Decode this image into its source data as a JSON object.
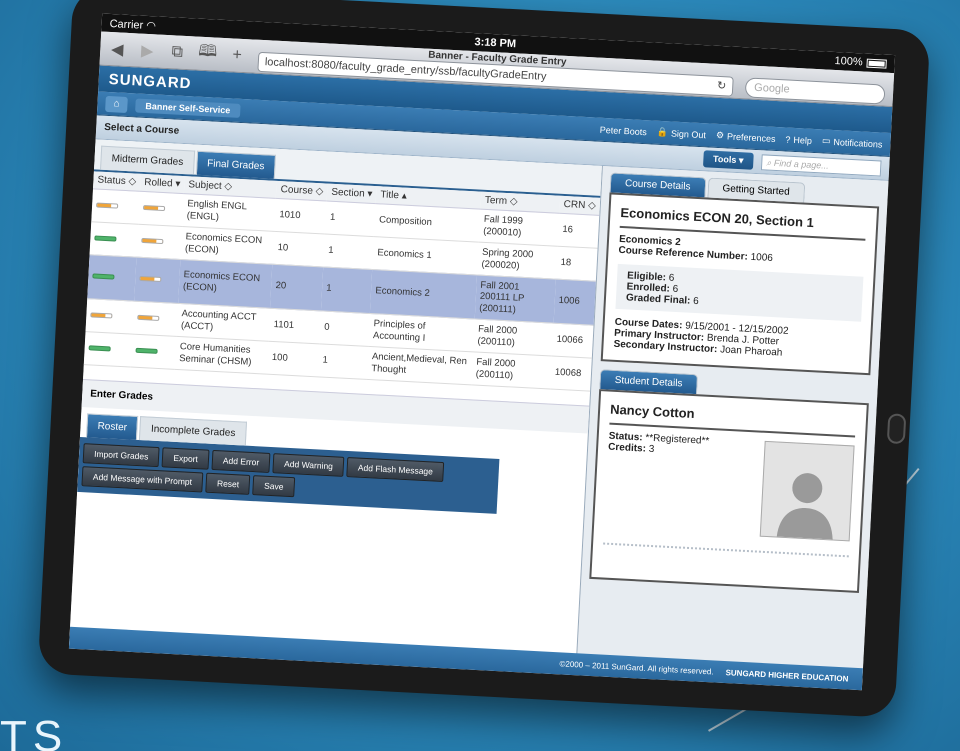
{
  "slide": {
    "partial_text": "TS"
  },
  "status_bar": {
    "carrier": "Carrier",
    "time": "3:18 PM",
    "battery": "100%"
  },
  "browser": {
    "page_title": "Banner - Faculty Grade Entry",
    "url": "localhost:8080/faculty_grade_entry/ssb/facultyGradeEntry",
    "search_placeholder": "Google"
  },
  "header": {
    "brand": "SUNGARD",
    "breadcrumb": "Banner Self-Service",
    "user": "Peter Boots",
    "sign_out": "Sign Out",
    "preferences": "Preferences",
    "help": "Help",
    "notifications": "Notifications"
  },
  "toolbar": {
    "title": "Select a Course",
    "tools": "Tools",
    "find_placeholder": "Find a page..."
  },
  "course_tabs": [
    "Midterm Grades",
    "Final Grades"
  ],
  "table": {
    "headers": [
      "Status",
      "Rolled",
      "Subject",
      "Course",
      "Section",
      "Title",
      "Term",
      "CRN"
    ],
    "rows": [
      {
        "status": "orange",
        "rolled": "orange",
        "subject": "English ENGL (ENGL)",
        "course": "1010",
        "section": "1",
        "title": "Composition",
        "term": "Fall 1999 (200010)",
        "crn": "16"
      },
      {
        "status": "green",
        "rolled": "orange",
        "subject": "Economics ECON (ECON)",
        "course": "10",
        "section": "1",
        "title": "Economics 1",
        "term": "Spring 2000 (200020)",
        "crn": "18"
      },
      {
        "status": "green",
        "rolled": "orange",
        "subject": "Economics ECON (ECON)",
        "course": "20",
        "section": "1",
        "title": "Economics 2",
        "term": "Fall 2001 200111 LP (200111)",
        "crn": "1006"
      },
      {
        "status": "orange",
        "rolled": "orange",
        "subject": "Accounting ACCT (ACCT)",
        "course": "1101",
        "section": "0",
        "title": "Principles of Accounting I",
        "term": "Fall 2000 (200110)",
        "crn": "10066"
      },
      {
        "status": "green",
        "rolled": "green",
        "subject": "Core Humanities Seminar (CHSM)",
        "course": "100",
        "section": "1",
        "title": "Ancient,Medieval, Ren Thought",
        "term": "Fall 2000 (200110)",
        "crn": "10068"
      }
    ]
  },
  "enter_grades": {
    "title": "Enter Grades",
    "tabs": [
      "Roster",
      "Incomplete Grades"
    ],
    "buttons": [
      "Import Grades",
      "Export",
      "Add Error",
      "Add Warning",
      "Add Flash Message",
      "Add Message with Prompt",
      "Reset",
      "Save"
    ]
  },
  "course_details": {
    "tabs": [
      "Course Details",
      "Getting Started"
    ],
    "title": "Economics ECON 20, Section 1",
    "name": "Economics 2",
    "crn_label": "Course Reference Number:",
    "crn": "1006",
    "eligible_label": "Eligible:",
    "eligible": "6",
    "enrolled_label": "Enrolled:",
    "enrolled": "6",
    "graded_label": "Graded Final:",
    "graded": "6",
    "dates_label": "Course Dates:",
    "dates": "9/15/2001 - 12/15/2002",
    "primary_label": "Primary Instructor:",
    "primary": "Brenda J. Potter",
    "secondary_label": "Secondary Instructor:",
    "secondary": "Joan Pharoah"
  },
  "student_details": {
    "tab": "Student Details",
    "name": "Nancy Cotton",
    "status_label": "Status:",
    "status": "**Registered**",
    "credits_label": "Credits:",
    "credits": "3"
  },
  "footer": {
    "copyright": "©2000 – 2011 SunGard. All rights reserved.",
    "brand": "SUNGARD HIGHER EDUCATION"
  }
}
